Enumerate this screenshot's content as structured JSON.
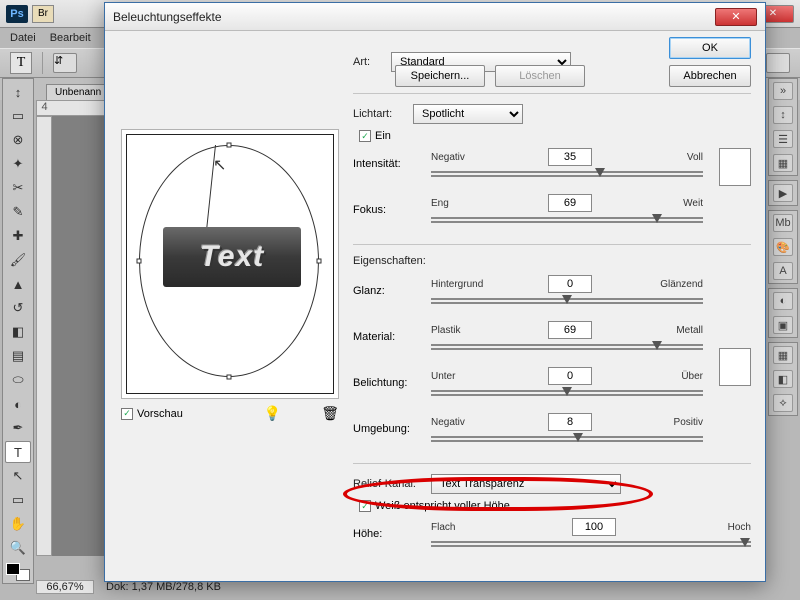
{
  "main": {
    "logo": "Ps",
    "br": "Br",
    "menu": {
      "file": "Datei",
      "edit": "Bearbeit"
    },
    "doc_tab": "Unbenann",
    "zoom": "66,67%",
    "dok": "Dok: 1,37 MB/278,8 KB",
    "ruler_mark": "4"
  },
  "dialog": {
    "title": "Beleuchtungseffekte",
    "ok": "OK",
    "cancel": "Abbrechen",
    "art_label": "Art:",
    "art_value": "Standard",
    "save": "Speichern...",
    "delete": "Löschen",
    "lichtart_label": "Lichtart:",
    "lichtart_value": "Spotlicht",
    "ein": "Ein",
    "intensitaet_label": "Intensität:",
    "intensitaet": {
      "left": "Negativ",
      "value": "35",
      "right": "Voll",
      "pos": 62
    },
    "fokus_label": "Fokus:",
    "fokus": {
      "left": "Eng",
      "value": "69",
      "right": "Weit",
      "pos": 83
    },
    "eigenschaften": "Eigenschaften:",
    "glanz_label": "Glanz:",
    "glanz": {
      "left": "Hintergrund",
      "value": "0",
      "right": "Glänzend",
      "pos": 50
    },
    "material_label": "Material:",
    "material": {
      "left": "Plastik",
      "value": "69",
      "right": "Metall",
      "pos": 83
    },
    "belichtung_label": "Belichtung:",
    "belichtung": {
      "left": "Unter",
      "value": "0",
      "right": "Über",
      "pos": 50
    },
    "umgebung_label": "Umgebung:",
    "umgebung": {
      "left": "Negativ",
      "value": "8",
      "right": "Positiv",
      "pos": 54
    },
    "relief_label": "Relief-Kanal:",
    "relief_value": "Text Transparenz",
    "weiss": "Weiß entspricht voller Höhe",
    "hoehe_label": "Höhe:",
    "hoehe": {
      "left": "Flach",
      "value": "100",
      "right": "Hoch",
      "pos": 98
    },
    "vorschau": "Vorschau",
    "preview_text": "Text"
  }
}
